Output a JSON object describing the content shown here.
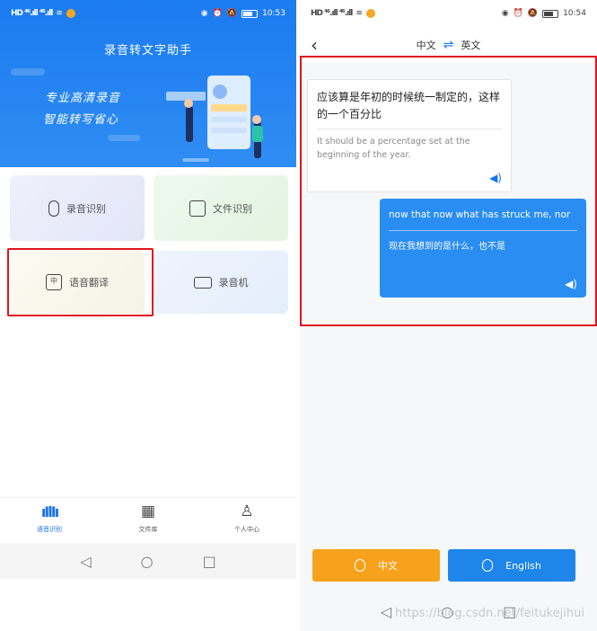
{
  "left": {
    "status": {
      "left": "HD ⁴⁶.ıll ⁴⁶.ıll",
      "time": "10:53"
    },
    "hero": {
      "title": "录音转文字助手",
      "slogan1": "专业高清录音",
      "slogan2": "智能转写省心"
    },
    "cards": {
      "record": "录音识别",
      "file": "文件识别",
      "translate": "语音翻译",
      "recorder": "录音机"
    },
    "nav": {
      "voice": "语音识别",
      "library": "文件库",
      "profile": "个人中心"
    },
    "colors": {
      "accent": "#1b7bf0",
      "highlight": "#e1141c"
    }
  },
  "right": {
    "status": {
      "left": "HD ⁴⁶.ıll ⁴⁶.ıll",
      "time": "10:54"
    },
    "header": {
      "lang_from": "中文",
      "lang_to": "英文",
      "swap": "⇌"
    },
    "messages": [
      {
        "source": "应该算是年初的时候统一制定的，这样的一个百分比",
        "translation": "It should be a percentage set at the beginning of the year."
      },
      {
        "source": "now that now what has struck me, nor",
        "translation": "现在我想到的是什么，也不是"
      }
    ],
    "buttons": {
      "chinese": "中文",
      "english": "English"
    },
    "colors": {
      "orange": "#f7a21c",
      "blue": "#1f86e9"
    }
  },
  "watermark": "https://blog.csdn.net/feitukejihui"
}
